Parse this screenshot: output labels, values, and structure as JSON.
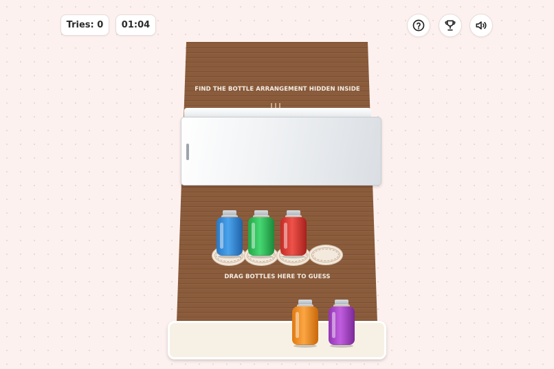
{
  "hud": {
    "tries_label": "Tries: 0",
    "timer": "01:04"
  },
  "board": {
    "hint_text": "FIND THE BOTTLE ARRANGEMENT HIDDEN INSIDE",
    "drop_text": "DRAG BOTTLES HERE TO GUESS"
  },
  "icons": {
    "help": "question-icon",
    "leaderboard": "trophy-icon",
    "sound": "speaker-icon"
  },
  "guess_bottles": [
    {
      "color": "blue",
      "hex": "#2f86d6"
    },
    {
      "color": "green",
      "hex": "#2fbf57"
    },
    {
      "color": "red",
      "hex": "#d7352f"
    }
  ],
  "tray_bottles": [
    {
      "color": "orange",
      "hex": "#f08a1c"
    },
    {
      "color": "purple",
      "hex": "#a43fc4"
    }
  ],
  "colors": {
    "wood": "#8a5c3c",
    "background": "#fdf1ef"
  }
}
